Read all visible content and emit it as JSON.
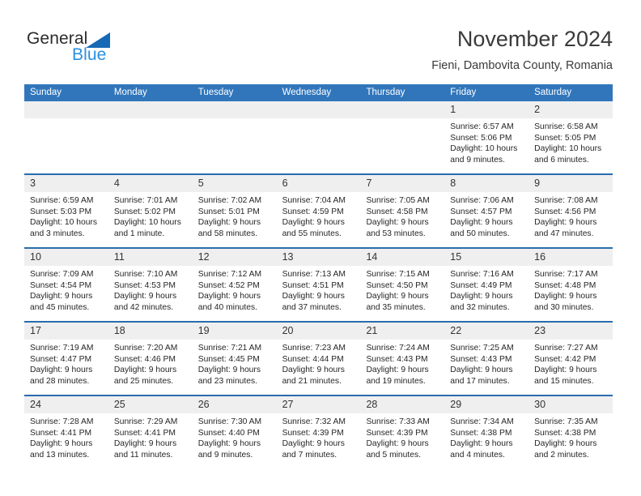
{
  "brand": {
    "name_part1": "General",
    "name_part2": "Blue",
    "triangle_color": "#1669b5",
    "blue_color": "#2a8fe0"
  },
  "header": {
    "title": "November 2024",
    "subtitle": "Fieni, Dambovita County, Romania"
  },
  "colors": {
    "header_blue": "#3176bb",
    "row_divider": "#2a6cae",
    "daynum_band": "#efefef"
  },
  "weekdays": [
    "Sunday",
    "Monday",
    "Tuesday",
    "Wednesday",
    "Thursday",
    "Friday",
    "Saturday"
  ],
  "weeks": [
    [
      {
        "day": "",
        "sunrise": "",
        "sunset": "",
        "daylight_line1": "",
        "daylight_line2": ""
      },
      {
        "day": "",
        "sunrise": "",
        "sunset": "",
        "daylight_line1": "",
        "daylight_line2": ""
      },
      {
        "day": "",
        "sunrise": "",
        "sunset": "",
        "daylight_line1": "",
        "daylight_line2": ""
      },
      {
        "day": "",
        "sunrise": "",
        "sunset": "",
        "daylight_line1": "",
        "daylight_line2": ""
      },
      {
        "day": "",
        "sunrise": "",
        "sunset": "",
        "daylight_line1": "",
        "daylight_line2": ""
      },
      {
        "day": "1",
        "sunrise": "Sunrise: 6:57 AM",
        "sunset": "Sunset: 5:06 PM",
        "daylight_line1": "Daylight: 10 hours",
        "daylight_line2": "and 9 minutes."
      },
      {
        "day": "2",
        "sunrise": "Sunrise: 6:58 AM",
        "sunset": "Sunset: 5:05 PM",
        "daylight_line1": "Daylight: 10 hours",
        "daylight_line2": "and 6 minutes."
      }
    ],
    [
      {
        "day": "3",
        "sunrise": "Sunrise: 6:59 AM",
        "sunset": "Sunset: 5:03 PM",
        "daylight_line1": "Daylight: 10 hours",
        "daylight_line2": "and 3 minutes."
      },
      {
        "day": "4",
        "sunrise": "Sunrise: 7:01 AM",
        "sunset": "Sunset: 5:02 PM",
        "daylight_line1": "Daylight: 10 hours",
        "daylight_line2": "and 1 minute."
      },
      {
        "day": "5",
        "sunrise": "Sunrise: 7:02 AM",
        "sunset": "Sunset: 5:01 PM",
        "daylight_line1": "Daylight: 9 hours",
        "daylight_line2": "and 58 minutes."
      },
      {
        "day": "6",
        "sunrise": "Sunrise: 7:04 AM",
        "sunset": "Sunset: 4:59 PM",
        "daylight_line1": "Daylight: 9 hours",
        "daylight_line2": "and 55 minutes."
      },
      {
        "day": "7",
        "sunrise": "Sunrise: 7:05 AM",
        "sunset": "Sunset: 4:58 PM",
        "daylight_line1": "Daylight: 9 hours",
        "daylight_line2": "and 53 minutes."
      },
      {
        "day": "8",
        "sunrise": "Sunrise: 7:06 AM",
        "sunset": "Sunset: 4:57 PM",
        "daylight_line1": "Daylight: 9 hours",
        "daylight_line2": "and 50 minutes."
      },
      {
        "day": "9",
        "sunrise": "Sunrise: 7:08 AM",
        "sunset": "Sunset: 4:56 PM",
        "daylight_line1": "Daylight: 9 hours",
        "daylight_line2": "and 47 minutes."
      }
    ],
    [
      {
        "day": "10",
        "sunrise": "Sunrise: 7:09 AM",
        "sunset": "Sunset: 4:54 PM",
        "daylight_line1": "Daylight: 9 hours",
        "daylight_line2": "and 45 minutes."
      },
      {
        "day": "11",
        "sunrise": "Sunrise: 7:10 AM",
        "sunset": "Sunset: 4:53 PM",
        "daylight_line1": "Daylight: 9 hours",
        "daylight_line2": "and 42 minutes."
      },
      {
        "day": "12",
        "sunrise": "Sunrise: 7:12 AM",
        "sunset": "Sunset: 4:52 PM",
        "daylight_line1": "Daylight: 9 hours",
        "daylight_line2": "and 40 minutes."
      },
      {
        "day": "13",
        "sunrise": "Sunrise: 7:13 AM",
        "sunset": "Sunset: 4:51 PM",
        "daylight_line1": "Daylight: 9 hours",
        "daylight_line2": "and 37 minutes."
      },
      {
        "day": "14",
        "sunrise": "Sunrise: 7:15 AM",
        "sunset": "Sunset: 4:50 PM",
        "daylight_line1": "Daylight: 9 hours",
        "daylight_line2": "and 35 minutes."
      },
      {
        "day": "15",
        "sunrise": "Sunrise: 7:16 AM",
        "sunset": "Sunset: 4:49 PM",
        "daylight_line1": "Daylight: 9 hours",
        "daylight_line2": "and 32 minutes."
      },
      {
        "day": "16",
        "sunrise": "Sunrise: 7:17 AM",
        "sunset": "Sunset: 4:48 PM",
        "daylight_line1": "Daylight: 9 hours",
        "daylight_line2": "and 30 minutes."
      }
    ],
    [
      {
        "day": "17",
        "sunrise": "Sunrise: 7:19 AM",
        "sunset": "Sunset: 4:47 PM",
        "daylight_line1": "Daylight: 9 hours",
        "daylight_line2": "and 28 minutes."
      },
      {
        "day": "18",
        "sunrise": "Sunrise: 7:20 AM",
        "sunset": "Sunset: 4:46 PM",
        "daylight_line1": "Daylight: 9 hours",
        "daylight_line2": "and 25 minutes."
      },
      {
        "day": "19",
        "sunrise": "Sunrise: 7:21 AM",
        "sunset": "Sunset: 4:45 PM",
        "daylight_line1": "Daylight: 9 hours",
        "daylight_line2": "and 23 minutes."
      },
      {
        "day": "20",
        "sunrise": "Sunrise: 7:23 AM",
        "sunset": "Sunset: 4:44 PM",
        "daylight_line1": "Daylight: 9 hours",
        "daylight_line2": "and 21 minutes."
      },
      {
        "day": "21",
        "sunrise": "Sunrise: 7:24 AM",
        "sunset": "Sunset: 4:43 PM",
        "daylight_line1": "Daylight: 9 hours",
        "daylight_line2": "and 19 minutes."
      },
      {
        "day": "22",
        "sunrise": "Sunrise: 7:25 AM",
        "sunset": "Sunset: 4:43 PM",
        "daylight_line1": "Daylight: 9 hours",
        "daylight_line2": "and 17 minutes."
      },
      {
        "day": "23",
        "sunrise": "Sunrise: 7:27 AM",
        "sunset": "Sunset: 4:42 PM",
        "daylight_line1": "Daylight: 9 hours",
        "daylight_line2": "and 15 minutes."
      }
    ],
    [
      {
        "day": "24",
        "sunrise": "Sunrise: 7:28 AM",
        "sunset": "Sunset: 4:41 PM",
        "daylight_line1": "Daylight: 9 hours",
        "daylight_line2": "and 13 minutes."
      },
      {
        "day": "25",
        "sunrise": "Sunrise: 7:29 AM",
        "sunset": "Sunset: 4:41 PM",
        "daylight_line1": "Daylight: 9 hours",
        "daylight_line2": "and 11 minutes."
      },
      {
        "day": "26",
        "sunrise": "Sunrise: 7:30 AM",
        "sunset": "Sunset: 4:40 PM",
        "daylight_line1": "Daylight: 9 hours",
        "daylight_line2": "and 9 minutes."
      },
      {
        "day": "27",
        "sunrise": "Sunrise: 7:32 AM",
        "sunset": "Sunset: 4:39 PM",
        "daylight_line1": "Daylight: 9 hours",
        "daylight_line2": "and 7 minutes."
      },
      {
        "day": "28",
        "sunrise": "Sunrise: 7:33 AM",
        "sunset": "Sunset: 4:39 PM",
        "daylight_line1": "Daylight: 9 hours",
        "daylight_line2": "and 5 minutes."
      },
      {
        "day": "29",
        "sunrise": "Sunrise: 7:34 AM",
        "sunset": "Sunset: 4:38 PM",
        "daylight_line1": "Daylight: 9 hours",
        "daylight_line2": "and 4 minutes."
      },
      {
        "day": "30",
        "sunrise": "Sunrise: 7:35 AM",
        "sunset": "Sunset: 4:38 PM",
        "daylight_line1": "Daylight: 9 hours",
        "daylight_line2": "and 2 minutes."
      }
    ]
  ]
}
